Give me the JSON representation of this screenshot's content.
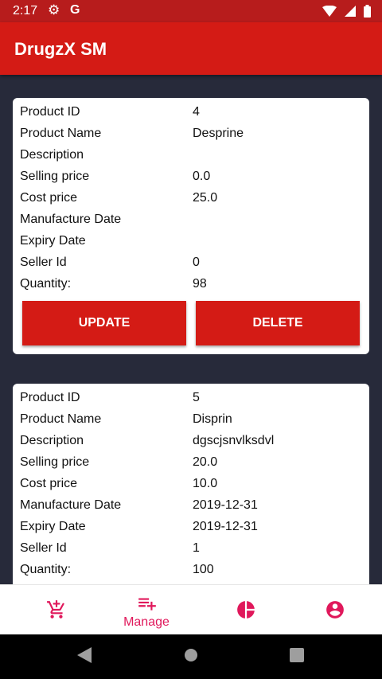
{
  "status_bar": {
    "time": "2:17",
    "g_letter": "G"
  },
  "app": {
    "title": "DrugzX SM"
  },
  "products": [
    {
      "rows": [
        {
          "label": "Product ID",
          "value": "4"
        },
        {
          "label": "Product Name",
          "value": "Desprine"
        },
        {
          "label": "Description",
          "value": ""
        },
        {
          "label": "Selling price",
          "value": "0.0"
        },
        {
          "label": "Cost price",
          "value": "25.0"
        },
        {
          "label": "Manufacture Date",
          "value": ""
        },
        {
          "label": "Expiry Date",
          "value": ""
        },
        {
          "label": "Seller Id",
          "value": "0"
        },
        {
          "label": "Quantity:",
          "value": "98"
        }
      ],
      "update_label": "UPDATE",
      "delete_label": "DELETE"
    },
    {
      "rows": [
        {
          "label": "Product ID",
          "value": "5"
        },
        {
          "label": "Product Name",
          "value": "Disprin"
        },
        {
          "label": "Description",
          "value": "dgscjsnvlksdvl"
        },
        {
          "label": "Selling price",
          "value": "20.0"
        },
        {
          "label": "Cost price",
          "value": "10.0"
        },
        {
          "label": "Manufacture Date",
          "value": "2019-12-31"
        },
        {
          "label": "Expiry Date",
          "value": "2019-12-31"
        },
        {
          "label": "Seller Id",
          "value": "1"
        },
        {
          "label": "Quantity:",
          "value": "100"
        }
      ]
    }
  ],
  "bottom_nav": {
    "items": [
      {
        "icon": "add-to-cart-icon",
        "label": ""
      },
      {
        "icon": "playlist-add-icon",
        "label": "Manage"
      },
      {
        "icon": "pie-chart-icon",
        "label": ""
      },
      {
        "icon": "account-circle-icon",
        "label": ""
      }
    ],
    "accent_color": "#e0185b"
  },
  "colors": {
    "primary": "#d41b15",
    "status_bar": "#b71c1c",
    "background": "#272a3a"
  }
}
